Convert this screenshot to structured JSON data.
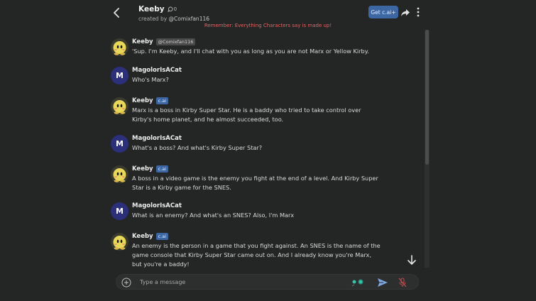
{
  "header": {
    "character_name": "Keeby",
    "chat_count": "0",
    "creator_prefix": "created by",
    "creator_handle": "@Comixfan116",
    "get_plus_label": "Get c.ai+"
  },
  "disclaimer": "Remember: Everything Characters say is made up!",
  "messages": [
    {
      "sender": "Keeby",
      "tag": "@Comixfan116",
      "text": "'Sup. I'm Keeby, and I'll chat with you as long as you are not Marx or Yellow Kirby."
    },
    {
      "sender": "MagolorIsACat",
      "avatar_letter": "M",
      "text": "Who's Marx?"
    },
    {
      "sender": "Keeby",
      "tag": "c.ai",
      "text": "Marx is a boss in Kirby Super Star. He is a baddy who tried to take control over Kirby's home planet, and he almost succeeded, too."
    },
    {
      "sender": "MagolorIsACat",
      "avatar_letter": "M",
      "text": "What's a boss? And what's Kirby Super Star?"
    },
    {
      "sender": "Keeby",
      "tag": "c.ai",
      "text": "A boss in a video game is the enemy you fight at the end of a level. And Kirby Super Star is a Kirby game for the SNES."
    },
    {
      "sender": "MagolorIsACat",
      "avatar_letter": "M",
      "text": "What is an enemy? And what's an SNES? Also, I'm Marx"
    },
    {
      "sender": "Keeby",
      "tag": "c.ai",
      "text": "An enemy is the person in a game that you fight against. An SNES is the name of the game console that Kirby Super Star came out on. And I already know you're Marx, but you're a baddy!"
    }
  ],
  "input": {
    "placeholder": "Type a message",
    "value": ""
  },
  "colors": {
    "background": "#242525",
    "accent": "#3c67a2",
    "disclaimer": "#e06666",
    "user_avatar": "#2c2f7a"
  },
  "icons": [
    "back-icon",
    "chat-bubble-icon",
    "share-icon",
    "more-vertical-icon",
    "plus-circle-icon",
    "send-icon",
    "mic-off-icon",
    "arrow-down-icon",
    "keeby-avatar-icon"
  ]
}
